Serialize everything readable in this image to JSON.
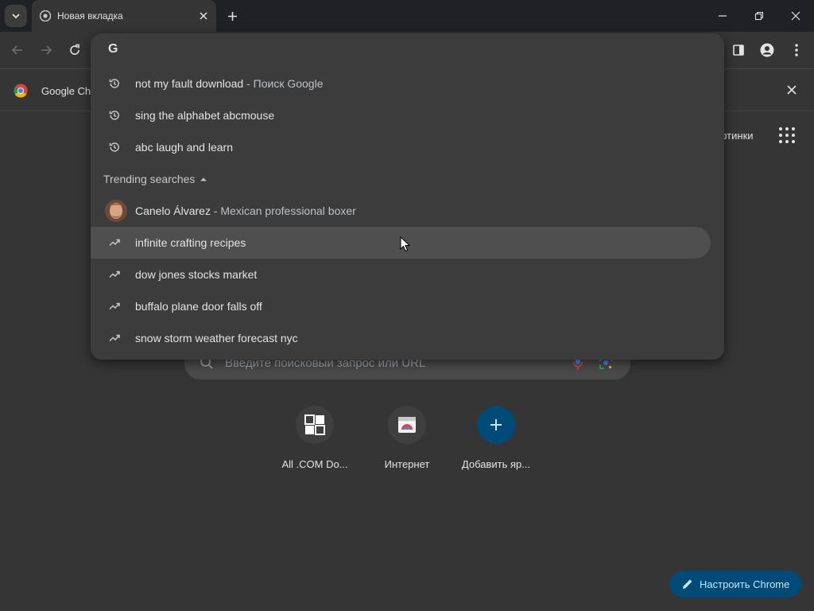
{
  "tab": {
    "title": "Новая вкладка"
  },
  "infobar": {
    "text": "Google Ch"
  },
  "ntp": {
    "images_link": "артинки",
    "search_placeholder": "Введите поисковый запрос или URL",
    "shortcuts": [
      {
        "label": "All .COM Do..."
      },
      {
        "label": "Интернет"
      },
      {
        "label": "Добавить яр..."
      }
    ],
    "customize_label": "Настроить Chrome"
  },
  "omnibox": {
    "history": [
      {
        "text": "not my fault download",
        "desc": "Поиск Google"
      },
      {
        "text": "sing the alphabet abcmouse",
        "desc": ""
      },
      {
        "text": "abc laugh and learn",
        "desc": ""
      }
    ],
    "trending_header": "Trending searches",
    "entity": {
      "text": "Canelo Álvarez",
      "desc": "Mexican professional boxer"
    },
    "trending": [
      {
        "text": "infinite crafting recipes"
      },
      {
        "text": "dow jones stocks market"
      },
      {
        "text": "buffalo plane door falls off"
      },
      {
        "text": "snow storm weather forecast nyc"
      }
    ]
  },
  "colors": {
    "accent_button": "#004a77",
    "accent_button_text": "#c2e7ff",
    "background": "#353535",
    "dropdown": "#3c3c3c"
  }
}
